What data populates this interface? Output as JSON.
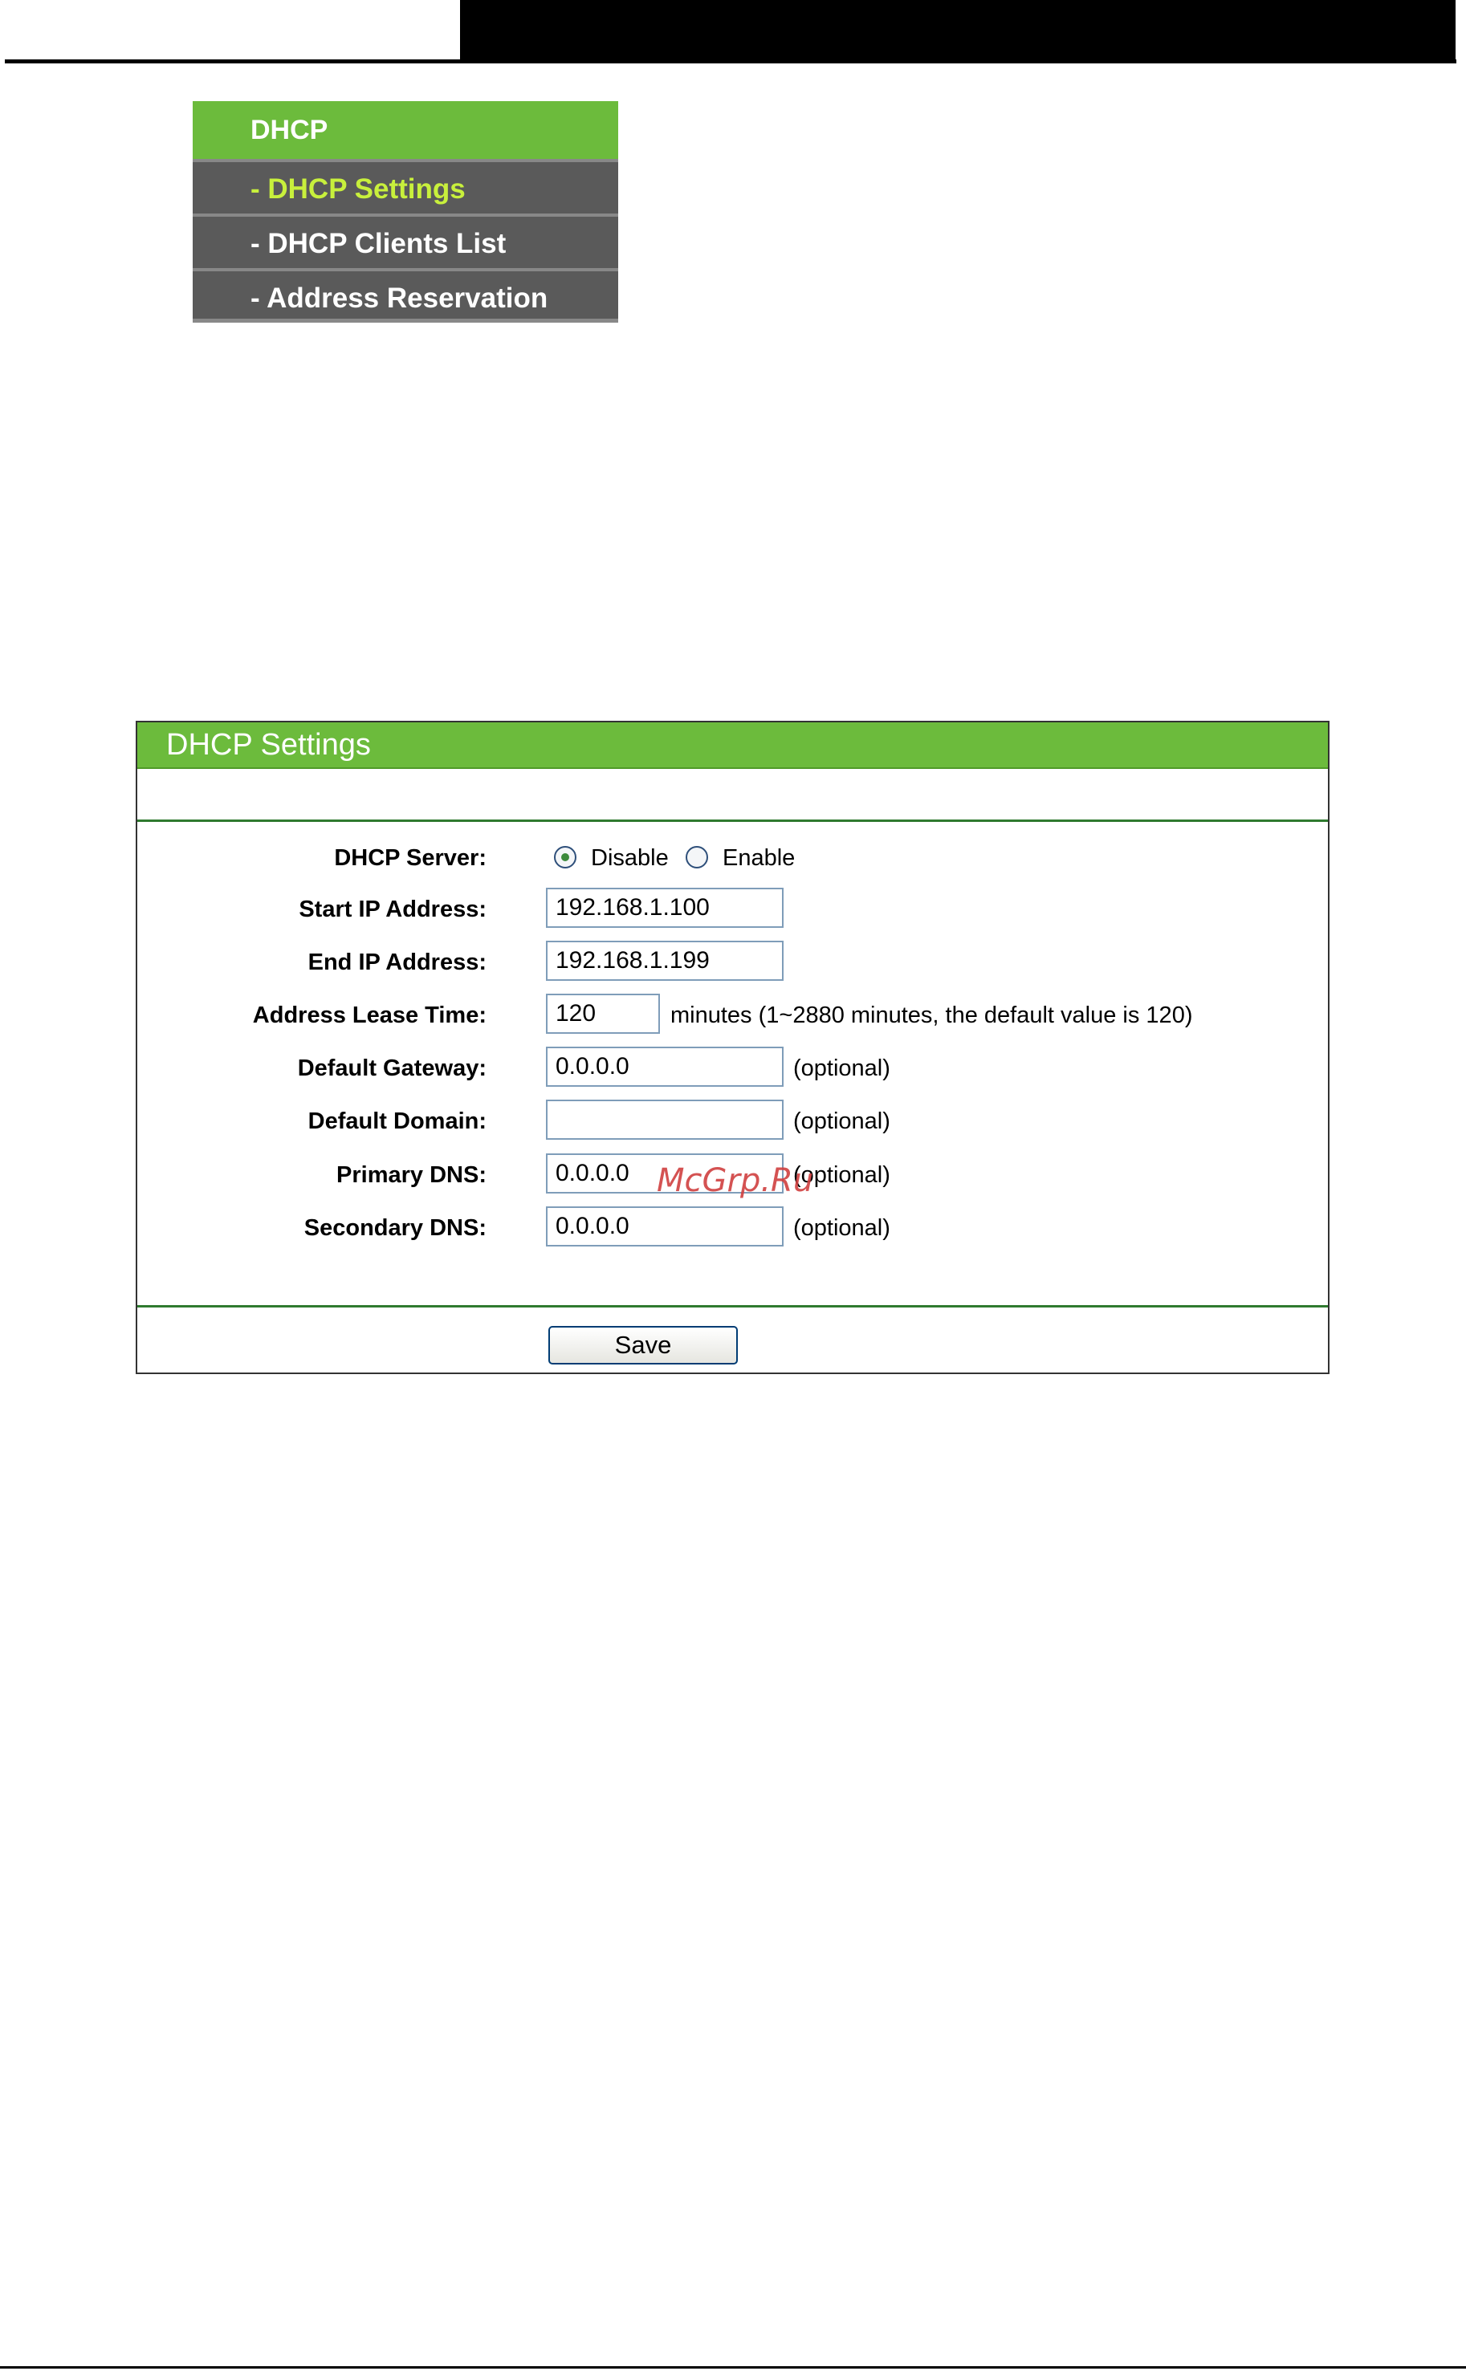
{
  "menu": {
    "header": "DHCP",
    "items": [
      {
        "label": "- DHCP Settings",
        "active": true
      },
      {
        "label": "- DHCP Clients List",
        "active": false
      },
      {
        "label": "- Address Reservation",
        "active": false
      }
    ]
  },
  "panel": {
    "title": "DHCP Settings",
    "dhcp_server": {
      "label": "DHCP Server:",
      "options": [
        "Disable",
        "Enable"
      ],
      "selected": "Disable"
    },
    "start_ip": {
      "label": "Start IP Address:",
      "value": "192.168.1.100"
    },
    "end_ip": {
      "label": "End IP Address:",
      "value": "192.168.1.199"
    },
    "lease_time": {
      "label": "Address Lease Time:",
      "value": "120",
      "hint": "minutes (1~2880 minutes, the default value is 120)"
    },
    "gateway": {
      "label": "Default Gateway:",
      "value": "0.0.0.0",
      "hint": "(optional)"
    },
    "domain": {
      "label": "Default Domain:",
      "value": "",
      "hint": "(optional)"
    },
    "primary_dns": {
      "label": "Primary DNS:",
      "value": "0.0.0.0",
      "hint": "(optional)"
    },
    "secondary_dns": {
      "label": "Secondary DNS:",
      "value": "0.0.0.0",
      "hint": "(optional)"
    },
    "save_label": "Save"
  },
  "watermark": "McGrp.Ru",
  "colors": {
    "accent_green": "#6cbb3c",
    "menu_gray": "#5a5a5a",
    "active_item": "#c8f03c",
    "divider_green": "#2f7a2f"
  }
}
